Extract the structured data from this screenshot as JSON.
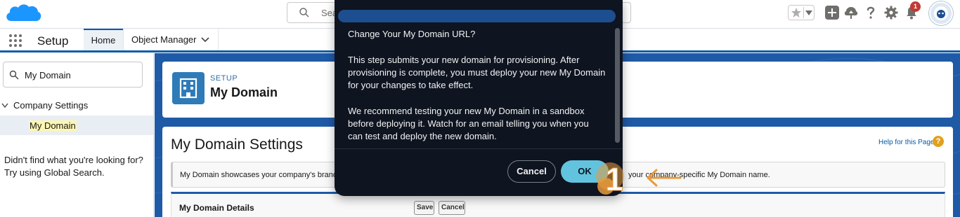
{
  "global_header": {
    "search_placeholder": "Sea",
    "notification_count": "1"
  },
  "setup_nav": {
    "app_name": "Setup",
    "tabs": [
      {
        "label": "Home"
      },
      {
        "label": "Object Manager"
      }
    ]
  },
  "sidebar": {
    "quickfind_value": "My Domain",
    "section_label": "Company Settings",
    "selected_item": "My Domain",
    "help_line1": "Didn't find what you're looking for?",
    "help_line2": "Try using Global Search."
  },
  "page_header": {
    "breadcrumb": "SETUP",
    "title": "My Domain"
  },
  "content": {
    "title": "My Domain Settings",
    "help_link": "Help for this Page",
    "help_icon": "?",
    "info_text_left": "My Domain showcases your company's brand an",
    "info_text_right": "your company-specific My Domain name.",
    "details_title": "My Domain Details",
    "save_label": "Save",
    "cancel_label": "Cancel"
  },
  "modal": {
    "heading": "Change Your My Domain URL?",
    "paragraph1": [
      "This step submits your new domain for provisioning. After",
      "provisioning is complete, you must deploy your new My Domain",
      "for your changes to take effect."
    ],
    "paragraph2": [
      "We recommend testing your new My Domain in a sandbox",
      "before deploying it. Watch for an email telling you when you",
      "can test and deploy the new domain."
    ],
    "cancel_label": "Cancel",
    "ok_label": "OK"
  },
  "annotation": {
    "step_number": "1",
    "color": "#e89a3c"
  },
  "colors": {
    "brand_blue": "#0b5cab",
    "modal_bg": "#0e1420",
    "ok_button": "#62c3de",
    "notification": "#c23934"
  }
}
